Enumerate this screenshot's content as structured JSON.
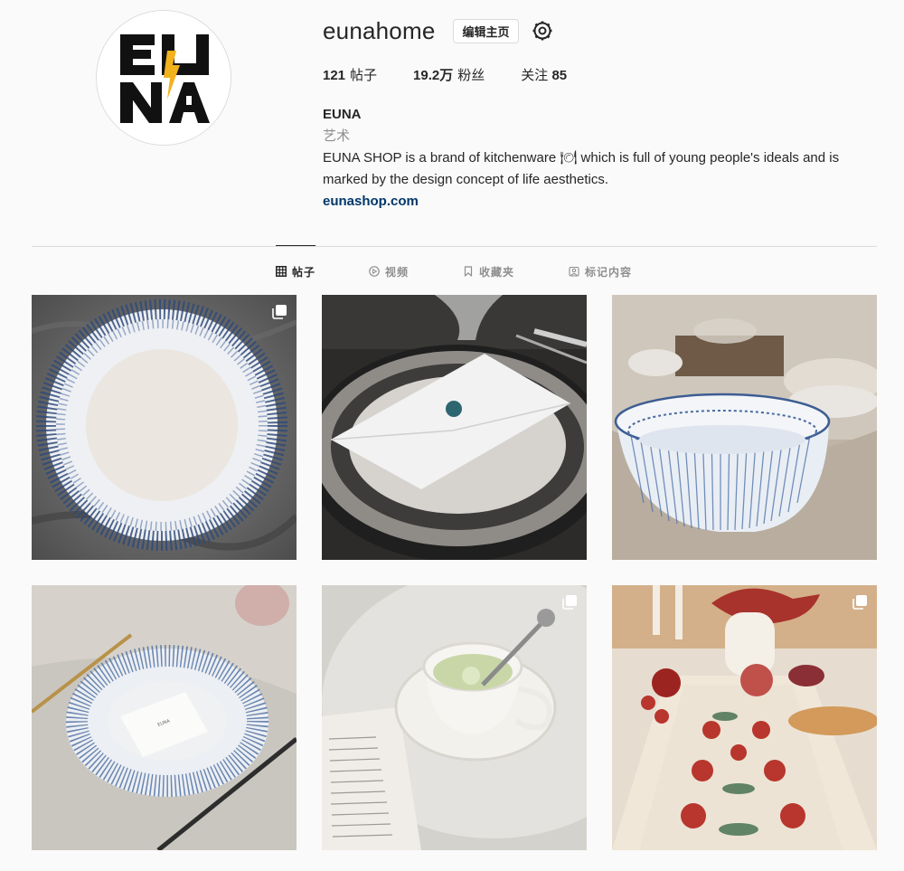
{
  "profile": {
    "username": "eunahome",
    "edit_label": "编辑主页",
    "stats": [
      {
        "value": "121",
        "unit": "帖子"
      },
      {
        "value": "19.2万",
        "unit": "粉丝"
      },
      {
        "label": "关注",
        "value": "85"
      }
    ],
    "name": "EUNA",
    "category": "艺术",
    "bio": "EUNA SHOP is a brand of kitchenware 🍽 which is full of young people's ideals and is marked by the design concept of life aesthetics.",
    "link": "eunashop.com",
    "avatar_text": [
      "EU",
      "NA"
    ]
  },
  "tabs": [
    {
      "label": "帖子",
      "icon": "grid-icon",
      "active": true
    },
    {
      "label": "视频",
      "icon": "play-icon",
      "active": false
    },
    {
      "label": "收藏夹",
      "icon": "bookmark-icon",
      "active": false
    },
    {
      "label": "标记内容",
      "icon": "tag-person-icon",
      "active": false
    }
  ],
  "posts": [
    {
      "subject": "blue-dotted-rim-plate",
      "multi": true
    },
    {
      "subject": "envelope-on-dark-plate",
      "multi": false
    },
    {
      "subject": "blue-striped-bowl",
      "multi": false
    },
    {
      "subject": "striped-plate-with-card",
      "multi": false
    },
    {
      "subject": "teacup-with-spoon",
      "multi": true
    },
    {
      "subject": "table-runner-pomegranates",
      "multi": true
    }
  ],
  "colors": {
    "background": "#fafafa",
    "link": "#00376b",
    "muted": "#8e8e8e",
    "border": "#dbdbdb",
    "logo_yellow": "#f2b21c"
  }
}
